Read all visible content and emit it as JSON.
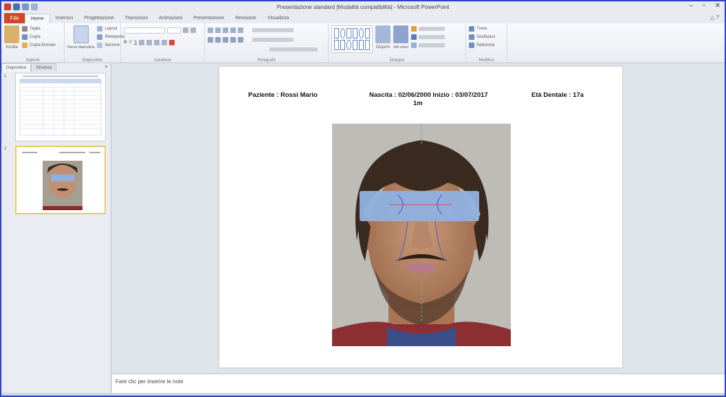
{
  "window": {
    "title": "Presentazione standard [Modalità compatibilità] - Microsoft PowerPoint"
  },
  "tabs": {
    "file": "File",
    "items": [
      "Home",
      "Inserisci",
      "Progettazione",
      "Transizioni",
      "Animazioni",
      "Presentazione",
      "Revisione",
      "Visualizza"
    ]
  },
  "ribbon": {
    "paste_label": "Incolla",
    "cut_label": "Taglia",
    "copy_label": "Copia",
    "format_painter_label": "Copia formato",
    "new_slide_label": "Nuova diapositiva",
    "layout_label": "Layout",
    "reset_label": "Reimposta",
    "section_label": "Sezione",
    "groups": {
      "clipboard": "Appunti",
      "slides": "Diapositive",
      "font": "Carattere",
      "paragraph": "Paragrafo",
      "drawing": "Disegno",
      "editing": "Modifica"
    },
    "arrange_label": "Disponi",
    "quick_styles_label": "Stili veloci",
    "find_label": "Trova",
    "replace_label": "Sostituisci",
    "select_label": "Seleziona"
  },
  "left_pane": {
    "tab_slides": "Diapositive",
    "tab_outline": "Struttura",
    "thumbs": [
      {
        "number": "1"
      },
      {
        "number": "2"
      }
    ]
  },
  "slide": {
    "patient": "Paziente : Rossi Mario",
    "birth_start": "Nascita : 02/06/2000  Inizio : 03/07/2017",
    "birth_start_wrap": "1m",
    "dental_age": "Età Dentale : 17a"
  },
  "notes": {
    "placeholder": "Fare clic per inserire le note"
  },
  "colors": {
    "file_tab": "#d24726",
    "window_border": "#2b3fc7",
    "overlay_blue": "#8fb1e0"
  }
}
